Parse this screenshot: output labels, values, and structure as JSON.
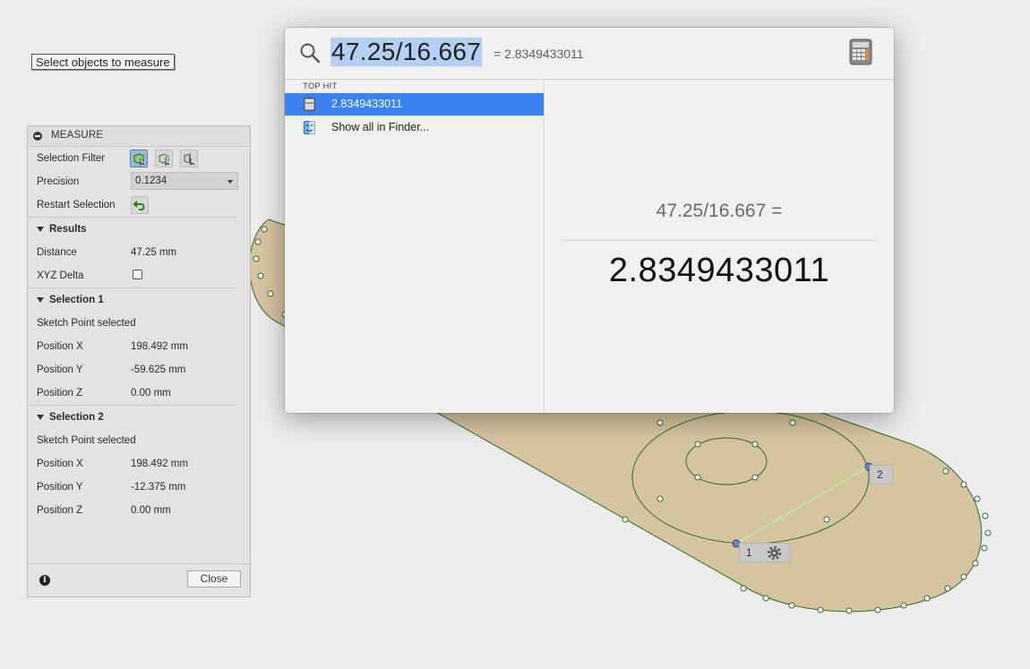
{
  "tooltip": {
    "text": "Select objects to measure"
  },
  "measure_panel": {
    "title": "MEASURE",
    "selection_filter_label": "Selection Filter",
    "precision_label": "Precision",
    "precision_value": "0.1234",
    "restart_label": "Restart Selection",
    "results": {
      "title": "Results",
      "distance_label": "Distance",
      "distance_value": "47.25 mm",
      "xyz_delta_label": "XYZ Delta",
      "xyz_delta_checked": false
    },
    "selection1": {
      "title": "Selection 1",
      "status": "Sketch Point selected",
      "x_label": "Position X",
      "x_value": "198.492 mm",
      "y_label": "Position Y",
      "y_value": "-59.625 mm",
      "z_label": "Position Z",
      "z_value": "0.00 mm"
    },
    "selection2": {
      "title": "Selection 2",
      "status": "Sketch Point selected",
      "x_label": "Position X",
      "x_value": "198.492 mm",
      "y_label": "Position Y",
      "y_value": "-12.375 mm",
      "z_label": "Position Z",
      "z_value": "0.00 mm"
    },
    "close_label": "Close"
  },
  "spotlight": {
    "query": "47.25/16.667",
    "inline_result": "= 2.8349433011",
    "category": "TOP HIT",
    "items": [
      {
        "label": "2.8349433011",
        "icon": "calculator-icon",
        "selected": true
      },
      {
        "label": "Show all in Finder...",
        "icon": "finder-icon",
        "selected": false
      }
    ],
    "preview": {
      "expression": "47.25/16.667 =",
      "result": "2.8349433011"
    }
  },
  "viewport": {
    "point1_label": "1",
    "point2_label": "2",
    "colors": {
      "part_fill": "#d6c3a0",
      "sketch_line": "#2f6b2a",
      "measure_line": "#b6f5a0",
      "selection_blue": "#3b82f0"
    }
  }
}
